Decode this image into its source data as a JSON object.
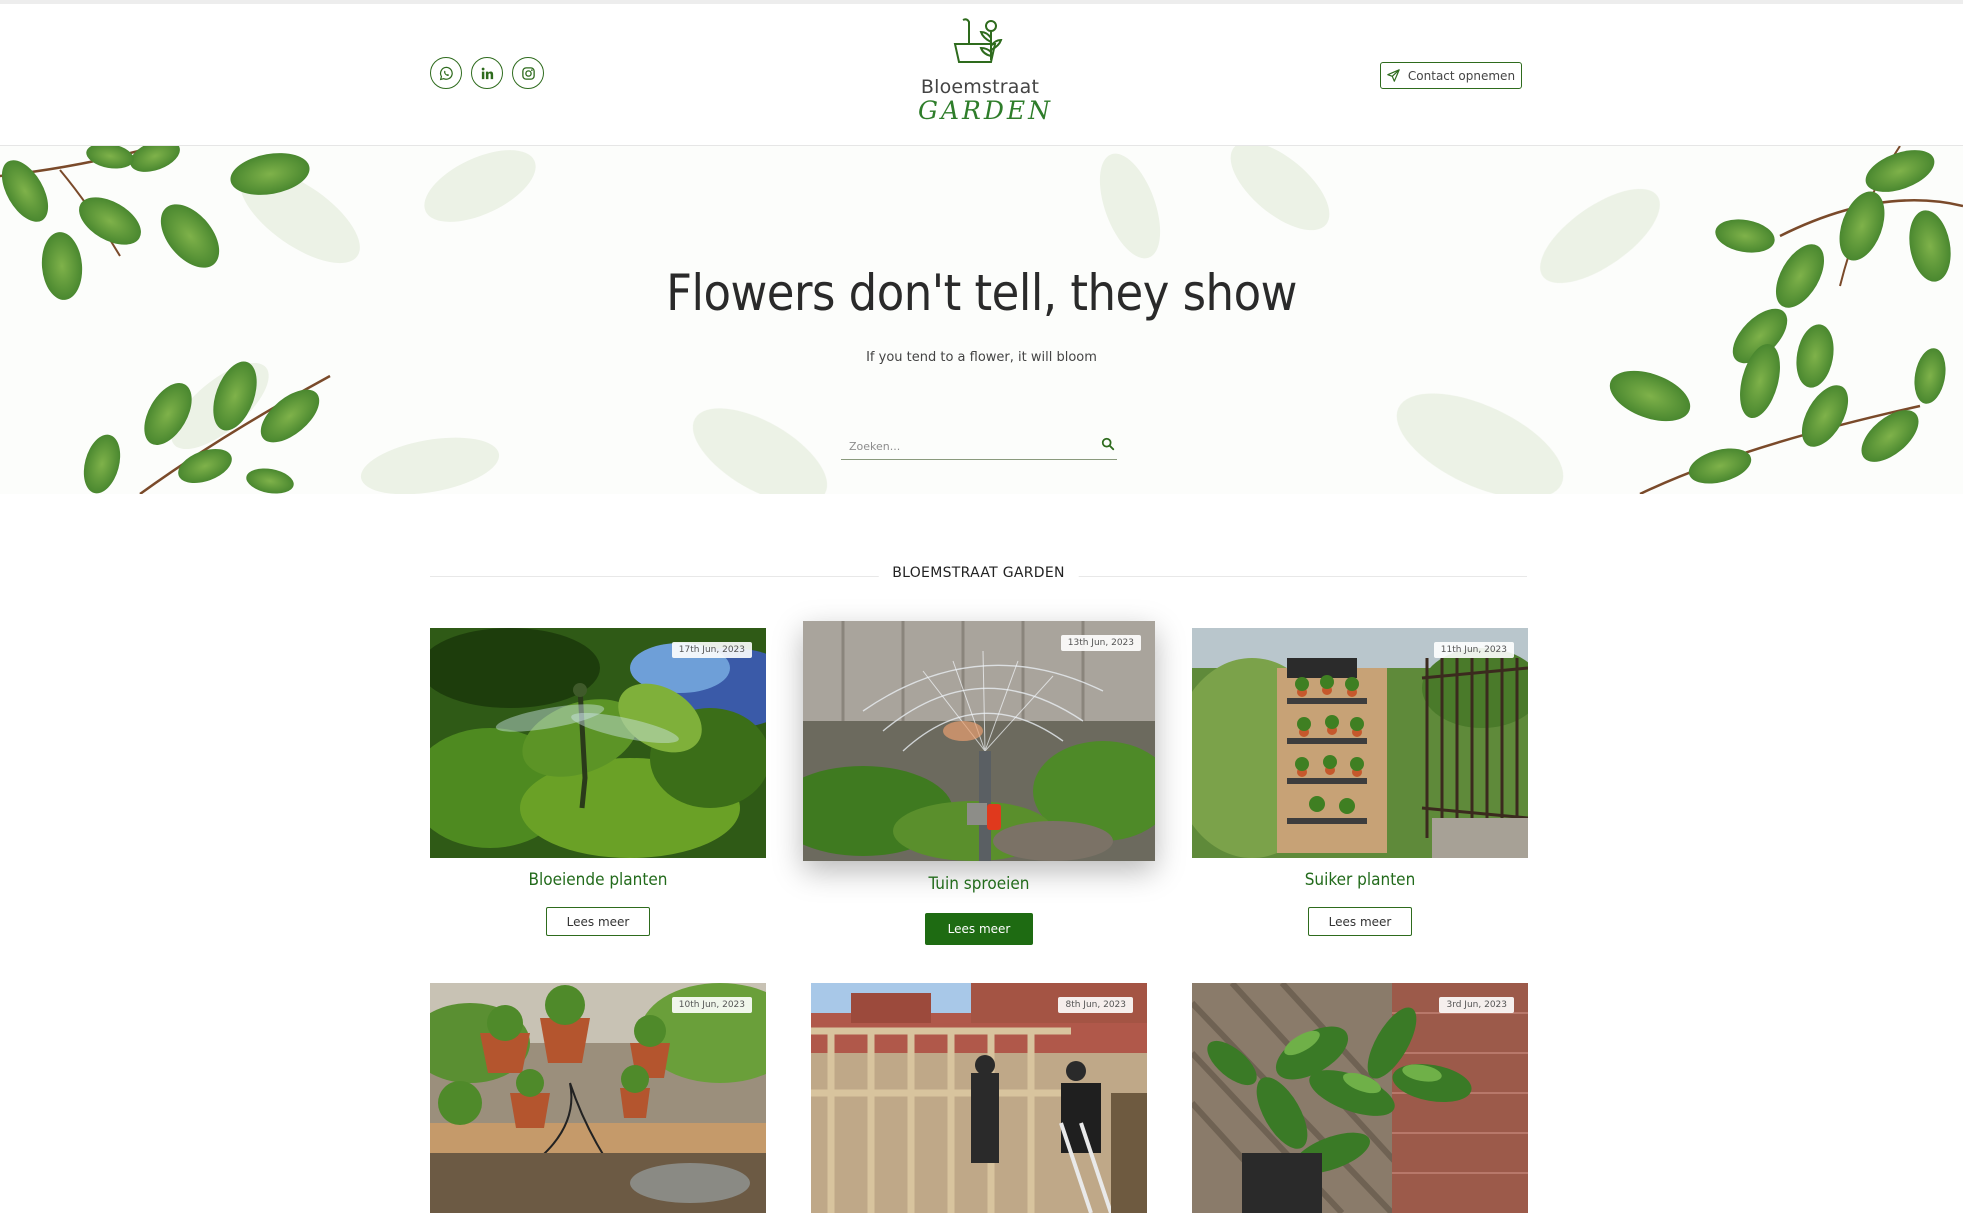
{
  "header": {
    "socials": [
      {
        "name": "whatsapp-icon"
      },
      {
        "name": "linkedin-icon"
      },
      {
        "name": "instagram-icon"
      }
    ],
    "logo": {
      "line1": "Bloemstraat",
      "line2": "GARDEN"
    },
    "contact_label": "Contact opnemen"
  },
  "hero": {
    "title": "Flowers don't tell, they show",
    "subtitle": "If you tend to a flower, it will bloom",
    "search_placeholder": "Zoeken..."
  },
  "section": {
    "title": "BLOEMSTRAAT GARDEN"
  },
  "colors": {
    "brand_green": "#1e6b12",
    "title_green": "#236b1c"
  },
  "posts": [
    {
      "date": "17th Jun, 2023",
      "title": "Bloeiende planten",
      "button": "Lees meer"
    },
    {
      "date": "13th Jun, 2023",
      "title": "Tuin sproeien",
      "button": "Lees meer"
    },
    {
      "date": "11th Jun, 2023",
      "title": "Suiker planten",
      "button": "Lees meer"
    },
    {
      "date": "10th Jun, 2023",
      "title": "",
      "button": ""
    },
    {
      "date": "8th Jun, 2023",
      "title": "",
      "button": ""
    },
    {
      "date": "3rd Jun, 2023",
      "title": "",
      "button": ""
    }
  ]
}
